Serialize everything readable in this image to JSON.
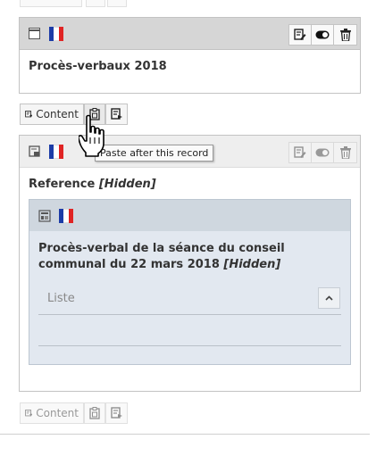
{
  "records": [
    {
      "title": "Procès-verbaux 2018",
      "flag": "flag-france",
      "icon": "page-content-icon"
    },
    {
      "title": "Reference",
      "hidden_tag": "[Hidden]",
      "flag": "flag-france",
      "icon": "shortcut-content-icon",
      "inner": {
        "title": "Procès-verbal de la séance du conseil communal du 22 mars 2018",
        "hidden_tag": "[Hidden]",
        "list_label": "Liste"
      }
    }
  ],
  "toolbar": {
    "content_label": "Content",
    "tooltip": "Paste after this record"
  },
  "colors": {
    "header_gray": "#d6d6d6",
    "inner_blue": "#e2e8f0",
    "flag_blue": "#1c3ca7",
    "flag_red": "#e02424"
  }
}
